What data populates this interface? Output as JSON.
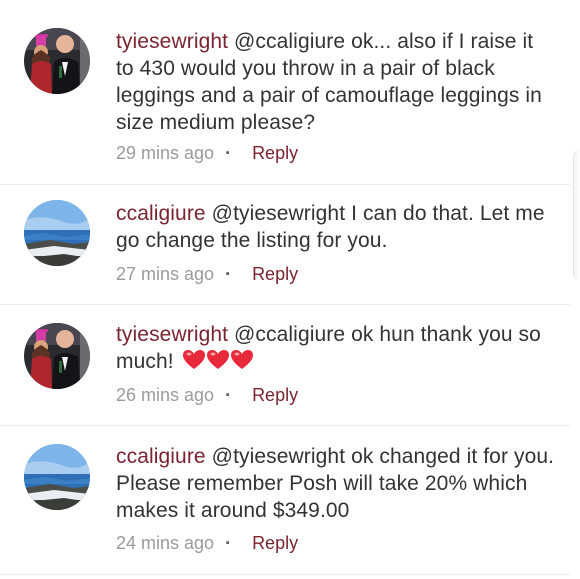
{
  "comments": [
    {
      "username": "tyiesewright",
      "avatar_icon": "couple-photo-avatar",
      "text": "@ccaligiure ok... also if I raise it to 430 would you throw in a pair of black leggings and a pair of camouflage leggings in size medium please?",
      "time": "29 mins ago",
      "reply_label": "Reply"
    },
    {
      "username": "ccaligiure",
      "avatar_icon": "ocean-coast-avatar",
      "text": "@tyiesewright I can do that. Let me go change the listing for you.",
      "time": "27 mins ago",
      "reply_label": "Reply"
    },
    {
      "username": "tyiesewright",
      "avatar_icon": "couple-photo-avatar",
      "text": "@ccaligiure ok hun thank you so much!",
      "hearts_icon": "three-red-hearts-emoji",
      "time": "26 mins ago",
      "reply_label": "Reply"
    },
    {
      "username": "ccaligiure",
      "avatar_icon": "ocean-coast-avatar",
      "text": "@tyiesewright ok  changed it for you. Please remember Posh will take 20% which makes it around $349.00",
      "time": "24 mins ago",
      "reply_label": "Reply"
    }
  ],
  "separator": "·",
  "colors": {
    "username": "#7a2430",
    "body_text": "#333333",
    "timestamp": "#9b9b9b",
    "heart": "#e8283b"
  }
}
